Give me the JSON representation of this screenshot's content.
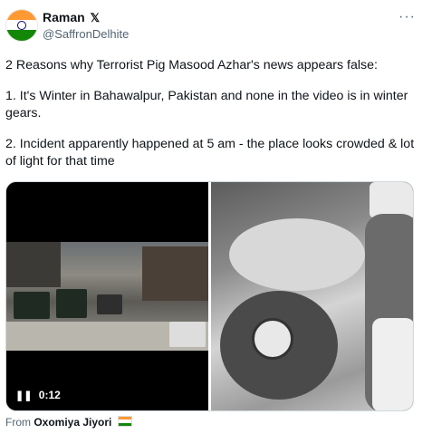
{
  "author": {
    "name": "Raman",
    "badge": "𝕏",
    "handle": "@SaffronDelhite"
  },
  "more_label": "···",
  "tweet": {
    "paragraphs": [
      "2 Reasons why Terrorist Pig Masood Azhar's news appears false:",
      "1. It's Winter in Bahawalpur, Pakistan and none in the video is in winter gears.",
      "2. Incident apparently happened at 5 am - the place looks crowded & lot of light for that time"
    ]
  },
  "media": {
    "video_duration": "0:12",
    "pause_icon": "pause-icon"
  },
  "source": {
    "prefix": "From",
    "account": "Oxomiya Jiyori"
  },
  "colors": {
    "text": "#0f1419",
    "secondary": "#536471",
    "border": "#cfd9de"
  }
}
